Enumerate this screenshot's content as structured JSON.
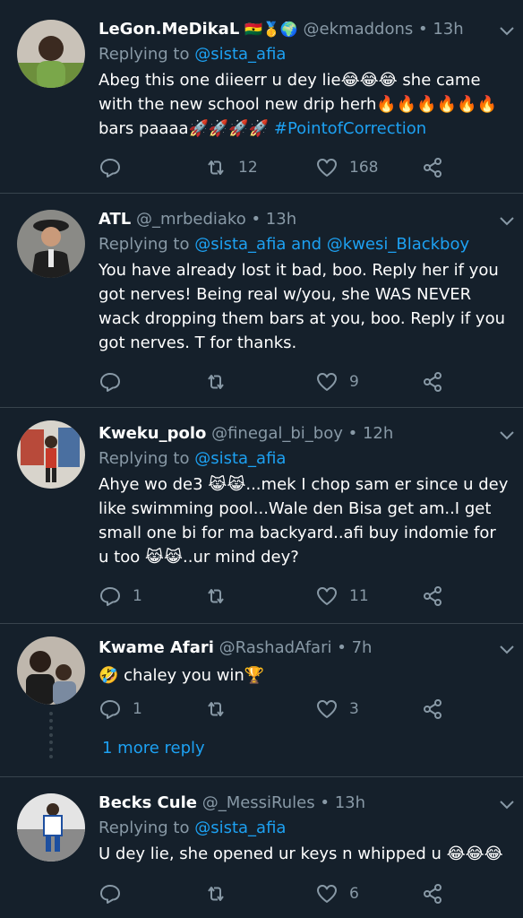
{
  "tweets": [
    {
      "name": "LeGon.MeDikaL",
      "badges": "🇬🇭🥇🌍",
      "handle": "@ekmaddons",
      "time": "13h",
      "reply_prefix": "Replying to ",
      "reply_to": "@sista_afia",
      "text_1": "Abeg this one diieerr u dey lie😂😂😂 she came with the new school new drip herh🔥🔥🔥🔥🔥🔥 bars paaaa🚀🚀🚀🚀 ",
      "hashtag": "#PointofCorrection",
      "replies": "",
      "retweets": "12",
      "likes": "168"
    },
    {
      "name": "ATL",
      "handle": "@_mrbediako",
      "time": "13h",
      "reply_prefix": "Replying to ",
      "reply_to": "@sista_afia and @kwesi_Blackboy",
      "text_1": "You have already lost it bad, boo. Reply her if you got nerves! Being real w/you, she WAS NEVER wack dropping them bars at you, boo. Reply if you got nerves. T for thanks.",
      "replies": "",
      "retweets": "",
      "likes": "9"
    },
    {
      "name": "Kweku_polo",
      "handle": "@finegal_bi_boy",
      "time": "12h",
      "reply_prefix": "Replying to ",
      "reply_to": "@sista_afia",
      "text_1": "Ahye wo de3 😹😹...mek I chop sam er since u dey like swimming pool...Wale den Bisa get am..I get small one bi for ma backyard..afi buy indomie for u too 😹😹..ur mind dey?",
      "replies": "1",
      "retweets": "",
      "likes": "11"
    },
    {
      "name": "Kwame Afari",
      "handle": "@RashadAfari",
      "time": "7h",
      "reply_prefix": "",
      "reply_to": "",
      "text_1": "🤣 chaley you win🏆",
      "replies": "1",
      "retweets": "",
      "likes": "3"
    },
    {
      "name": "Becks Cule",
      "handle": "@_MessiRules",
      "time": "13h",
      "reply_prefix": "Replying to ",
      "reply_to": "@sista_afia",
      "text_1": "U dey lie, she opened ur keys n whipped u 😂😂😂",
      "replies": "",
      "retweets": "",
      "likes": "6"
    }
  ],
  "more_replies": "1 more reply",
  "separator": "•",
  "icons": [
    "chevron-down-icon",
    "reply-icon",
    "retweet-icon",
    "like-icon",
    "share-icon"
  ],
  "colors": {
    "background": "#15202b",
    "secondary_text": "#8899a6",
    "link": "#1da1f2",
    "divider": "#38444d"
  }
}
